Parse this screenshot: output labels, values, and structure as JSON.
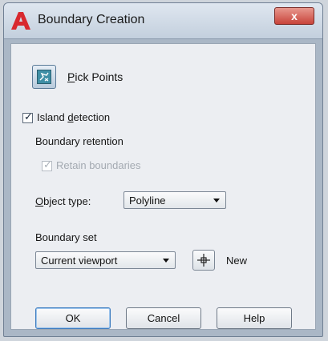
{
  "window": {
    "title": "Boundary Creation",
    "close_label": "x"
  },
  "pick_points": {
    "label_accesskey": "P",
    "label_rest": "ick Points"
  },
  "island_detection": {
    "checked": true,
    "label_pre": "Island ",
    "label_accesskey": "d",
    "label_post": "etection",
    "check_glyph": "✓"
  },
  "boundary_retention": {
    "heading": "Boundary retention",
    "retain": {
      "checked": true,
      "disabled": true,
      "label": "Retain boundaries",
      "check_glyph": "✓"
    },
    "object_type": {
      "label_accesskey": "O",
      "label_rest": "bject type:",
      "value": "Polyline"
    }
  },
  "boundary_set": {
    "heading": "Boundary set",
    "value": "Current viewport",
    "new_label": "New"
  },
  "buttons": {
    "ok": "OK",
    "cancel": "Cancel",
    "help": "Help"
  },
  "icons": {
    "app": "autocad-logo-icon",
    "pick": "pick-points-icon",
    "new": "select-objects-crosshair-icon"
  },
  "colors": {
    "app_logo": "#d8292f",
    "title_close": "#c8433a",
    "pick_icon": "#3f8fa6"
  }
}
